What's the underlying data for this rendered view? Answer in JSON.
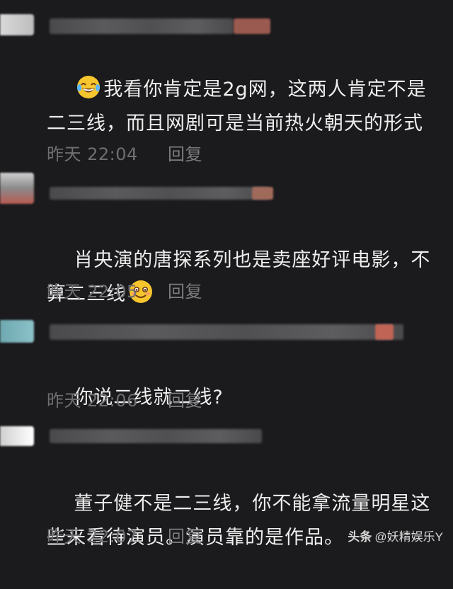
{
  "comments": [
    {
      "text_before": "我看你肯定是2g网，这两人肯定不是二三线，而且网剧可是当前热火朝天的形式",
      "emoji": "laughing-tears-emoji",
      "date": "昨天",
      "time": "22:04",
      "reply_label": "回复"
    },
    {
      "text_before": "肖央演的唐探系列也是卖座好评电影，不算二三线",
      "emoji": "smiling-face-emoji",
      "date": "昨天",
      "time": "22:05",
      "reply_label": "回复"
    },
    {
      "text_before": "你说二线就二线?",
      "date": "昨天",
      "time": "22:06",
      "reply_label": "回复"
    },
    {
      "text_before": "董子健不是二三线，你不能拿流量明星这些来看待演员。演员靠的是作品。",
      "date": "昨天",
      "time": "22:07",
      "reply_label": "回复"
    }
  ],
  "watermark": {
    "brand": "头条",
    "handle": "@妖精娱乐Y"
  },
  "colors": {
    "background": "#1b1b1d",
    "text": "#eeeeee",
    "meta": "#6f6f72"
  }
}
